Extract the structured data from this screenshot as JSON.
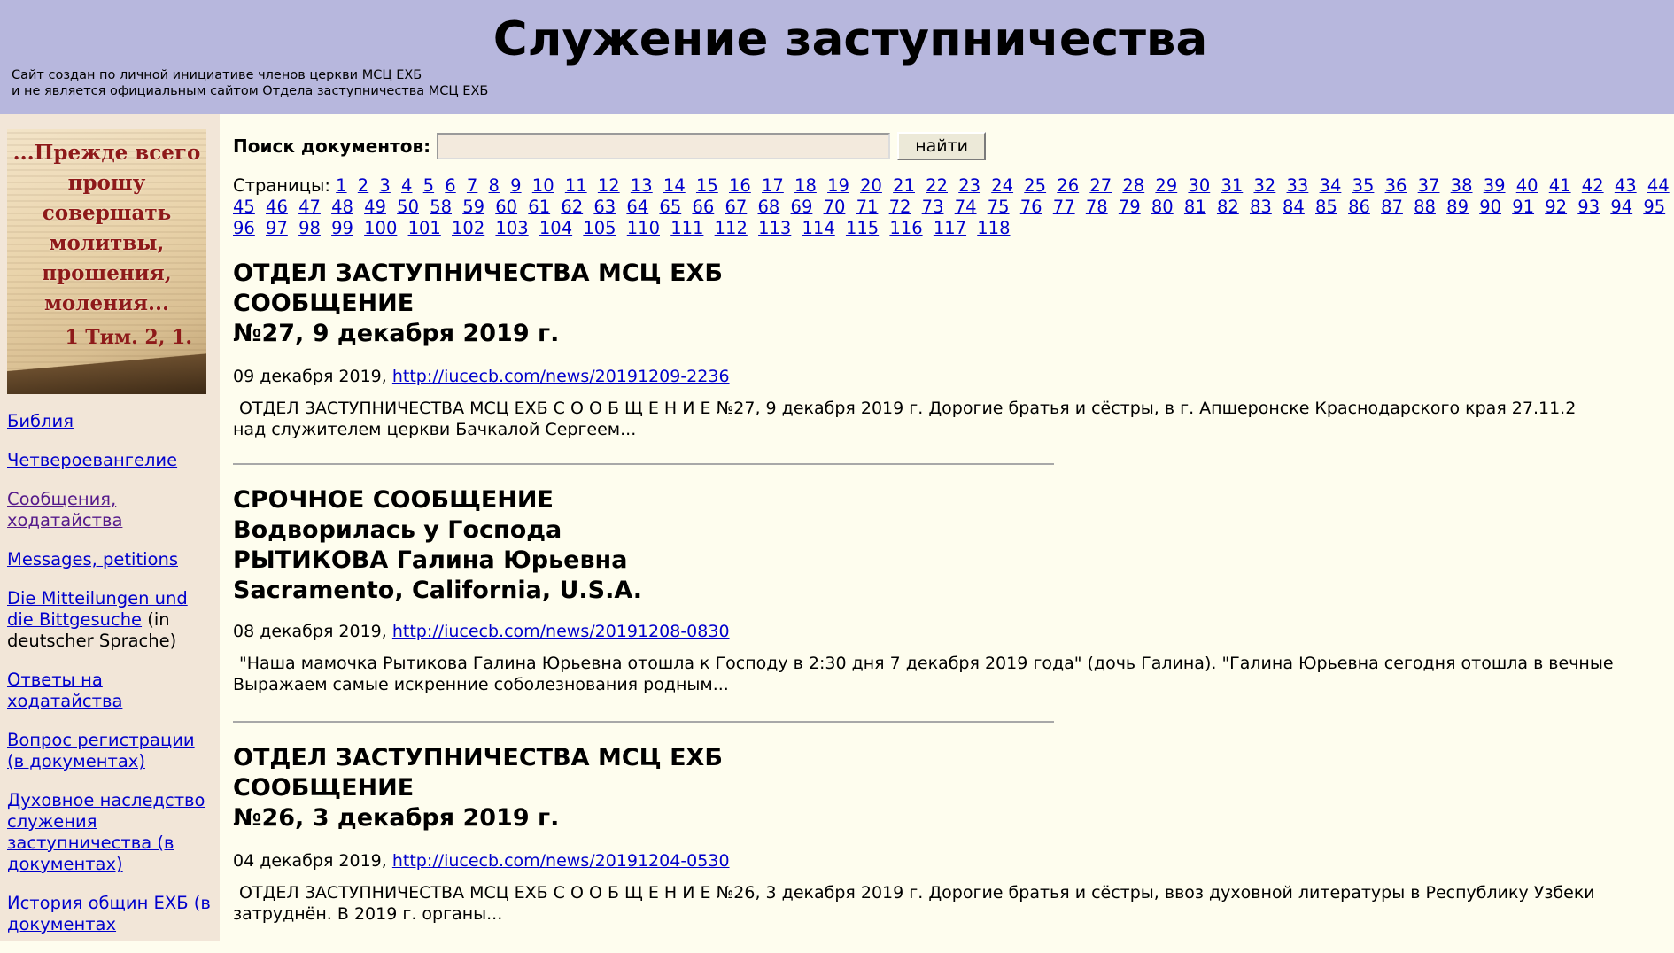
{
  "header": {
    "title": "Служение заступничества",
    "disclaimer_line1": "Сайт создан по личной инициативе членов церкви МСЦ ЕХБ",
    "disclaimer_line2": "и не является официальным сайтом Отдела заступничества МСЦ ЕХБ"
  },
  "banner": {
    "lines": [
      "...Прежде всего",
      "прошу",
      "совершать",
      "молитвы,",
      "прошения,",
      "моления..."
    ],
    "reference": "1 Тим. 2, 1."
  },
  "nav": [
    {
      "label": "Библия"
    },
    {
      "label": "Четвероевангелие"
    },
    {
      "label": "Сообщения, ходатайства"
    },
    {
      "label": "Messages, petitions"
    },
    {
      "label": "Die Mitteilungen und die Bittgesuche",
      "extra": "(in deutscher Sprache)"
    },
    {
      "label": "Ответы на ходатайства"
    },
    {
      "label": "Вопрос регистрации (в документах)"
    },
    {
      "label": "Духовное наследство служения заступничества (в документах)"
    },
    {
      "label": "История общин ЕХБ (в документах"
    }
  ],
  "search": {
    "label": "Поиск документов:",
    "value": "",
    "button": "найти"
  },
  "pagination": {
    "label": "Страницы:",
    "pages": [
      "1",
      "2",
      "3",
      "4",
      "5",
      "6",
      "7",
      "8",
      "9",
      "10",
      "11",
      "12",
      "13",
      "14",
      "15",
      "16",
      "17",
      "18",
      "19",
      "20",
      "21",
      "22",
      "23",
      "24",
      "25",
      "26",
      "27",
      "28",
      "29",
      "30",
      "31",
      "32",
      "33",
      "34",
      "35",
      "36",
      "37",
      "38",
      "39",
      "40",
      "41",
      "42",
      "43",
      "44",
      "45",
      "46",
      "47",
      "48",
      "49",
      "50",
      "58",
      "59",
      "60",
      "61",
      "62",
      "63",
      "64",
      "65",
      "66",
      "67",
      "68",
      "69",
      "70",
      "71",
      "72",
      "73",
      "74",
      "75",
      "76",
      "77",
      "78",
      "79",
      "80",
      "81",
      "82",
      "83",
      "84",
      "85",
      "86",
      "87",
      "88",
      "89",
      "90",
      "91",
      "92",
      "93",
      "94",
      "95",
      "96",
      "97",
      "98",
      "99",
      "100",
      "101",
      "102",
      "103",
      "104",
      "105",
      "110",
      "111",
      "112",
      "113",
      "114",
      "115",
      "116",
      "117",
      "118"
    ]
  },
  "articles": [
    {
      "title_lines": [
        "ОТДЕЛ ЗАСТУПНИЧЕСТВА МСЦ ЕХБ",
        "СООБЩЕНИЕ",
        "№27, 9 декабря 2019 г."
      ],
      "date": "09 декабря 2019,",
      "url": "http://iucecb.com/news/20191209-2236",
      "snippet_line1": "ОТДЕЛ ЗАСТУПНИЧЕСТВА МСЦ ЕХБ  С О О Б Щ Е Н И Е  №27, 9 декабря 2019 г.   Дорогие братья и сёстры, в г. Апшеронске Краснодарского края 27.11.2",
      "snippet_line2": "над служителем церкви Бачкалой Сергеем..."
    },
    {
      "title_lines": [
        "СРОЧНОЕ СООБЩЕНИЕ",
        "Водворилась у Господа",
        "РЫТИКОВА Галина Юрьевна",
        "Sacramento, California, U.S.A."
      ],
      "date": "08 декабря 2019,",
      "url": "http://iucecb.com/news/20191208-0830",
      "snippet_line1": "\"Наша мамочка Рытикова Галина Юрьевна  отошла к Господу в 2:30 дня 7 декабря 2019 года\" (дочь Галина). \"Галина Юрьевна сегодня отошла в вечные",
      "snippet_line2": "Выражаем самые искренние соболезнования родным..."
    },
    {
      "title_lines": [
        "ОТДЕЛ ЗАСТУПНИЧЕСТВА МСЦ ЕХБ",
        "СООБЩЕНИЕ",
        "№26, 3 декабря 2019 г."
      ],
      "date": "04 декабря 2019,",
      "url": "http://iucecb.com/news/20191204-0530",
      "snippet_line1": "ОТДЕЛ ЗАСТУПНИЧЕСТВА МСЦ ЕХБ  С О О Б Щ Е Н И Е  №26, 3 декабря 2019 г. Дорогие братья и сёстры, ввоз духовной литературы в Республику Узбеки",
      "snippet_line2": "затруднён. В 2019 г. органы..."
    }
  ]
}
